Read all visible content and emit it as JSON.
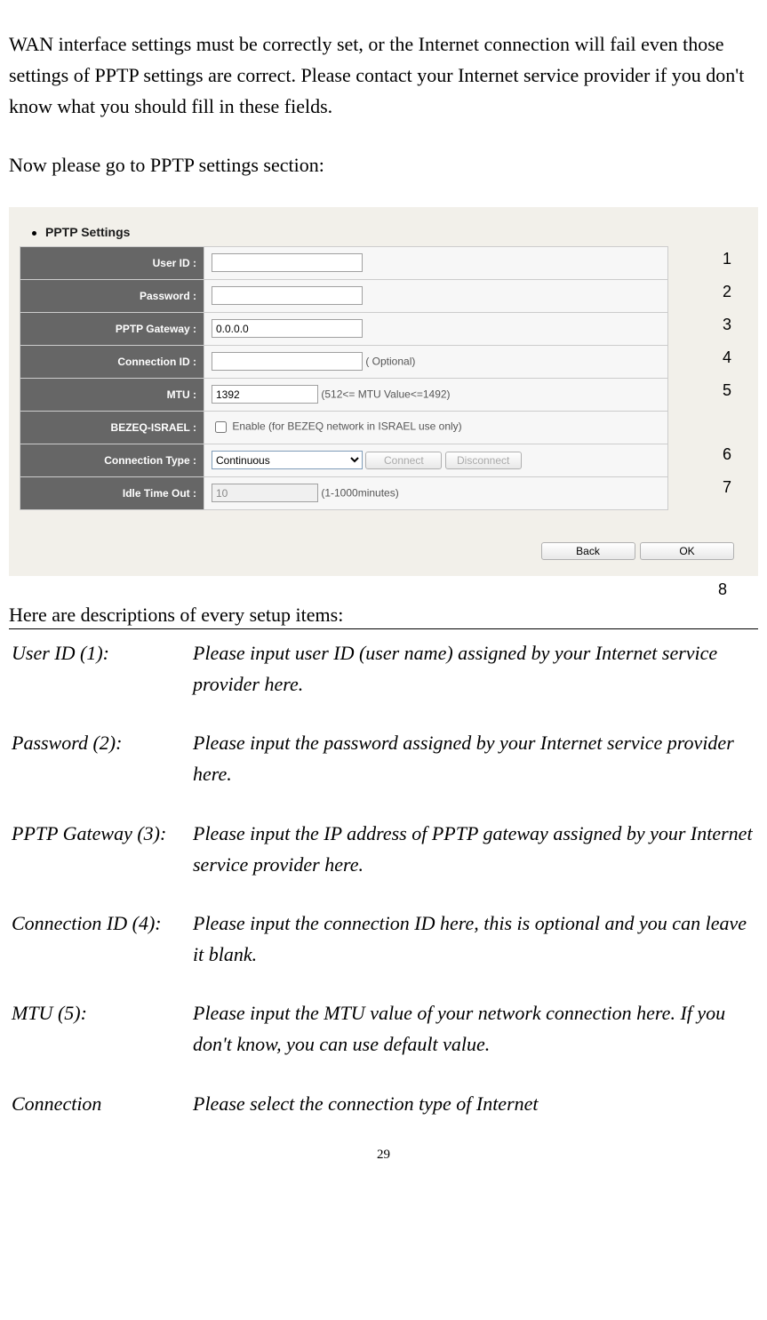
{
  "intro_text": "WAN interface settings must be correctly set, or the Internet connection will fail even those settings of PPTP settings are correct. Please contact your Internet service provider if you don't know what you should fill in these fields.",
  "goto_text": "Now please go to PPTP settings section:",
  "screenshot": {
    "title": "PPTP Settings",
    "rows": {
      "user_id": {
        "label": "User ID :",
        "value": ""
      },
      "password": {
        "label": "Password :",
        "value": ""
      },
      "pptp_gateway": {
        "label": "PPTP Gateway :",
        "value": "0.0.0.0"
      },
      "connection_id": {
        "label": "Connection ID :",
        "value": "",
        "hint": "( Optional)"
      },
      "mtu": {
        "label": "MTU :",
        "value": "1392",
        "hint": "(512<= MTU Value<=1492)"
      },
      "bezeq": {
        "label": "BEZEQ-ISRAEL :",
        "hint": "Enable (for BEZEQ network in ISRAEL use only)"
      },
      "connection_type": {
        "label": "Connection Type :",
        "value": "Continuous",
        "connect_btn": "Connect",
        "disconnect_btn": "Disconnect"
      },
      "idle_timeout": {
        "label": "Idle Time Out :",
        "value": "10",
        "hint": "(1-1000minutes)"
      }
    },
    "buttons": {
      "back": "Back",
      "ok": "OK"
    },
    "annotations": {
      "a1": "1",
      "a2": "2",
      "a3": "3",
      "a4": "4",
      "a5": "5",
      "a6": "6",
      "a7": "7",
      "a8": "8"
    }
  },
  "desc_header": "Here are descriptions of every setup items:",
  "descriptions": [
    {
      "label": "User ID (1):",
      "text": "Please input user ID (user name) assigned by your Internet service provider here."
    },
    {
      "label": "Password (2):",
      "text": "Please input the password assigned by your Internet service provider here."
    },
    {
      "label": "PPTP Gateway (3):",
      "text": "Please input the IP address of PPTP gateway assigned by your Internet service provider here."
    },
    {
      "label": "Connection ID (4):",
      "text": "Please input the connection ID here, this is optional and you can leave it blank."
    },
    {
      "label": "MTU (5):",
      "text": "Please input the MTU value of your network connection here. If you don't know, you can use default value."
    },
    {
      "label": "Connection",
      "text": "Please select the connection type of Internet"
    }
  ],
  "page_number": "29"
}
